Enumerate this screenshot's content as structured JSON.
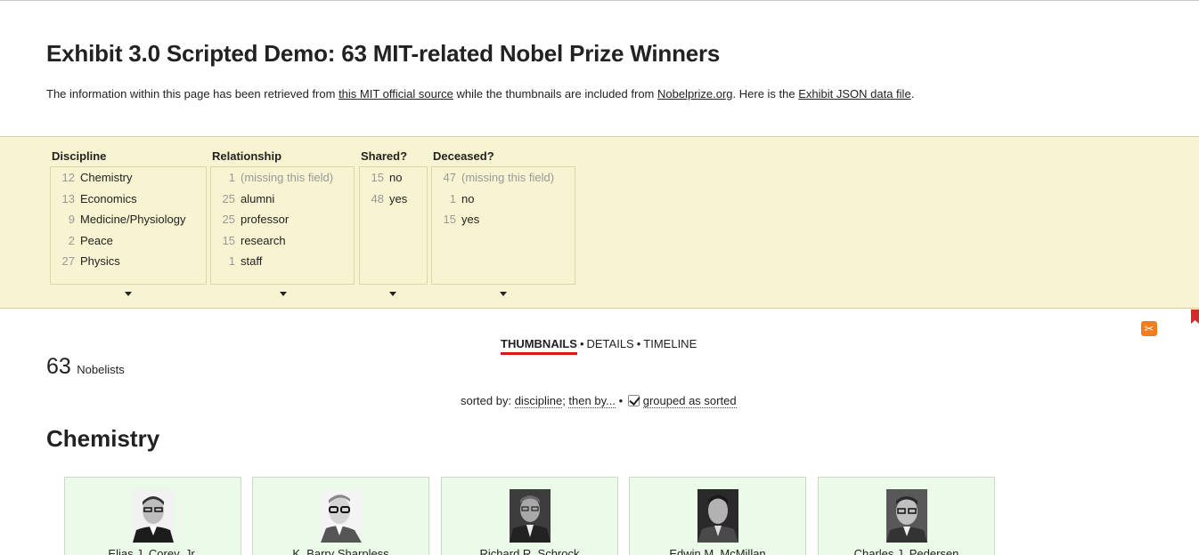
{
  "page": {
    "title": "Exhibit 3.0 Scripted Demo: 63 MIT-related Nobel Prize Winners",
    "intro": {
      "text1": "The information within this page has been retrieved from ",
      "link1": "this MIT official source",
      "text2": " while the thumbnails are included from ",
      "link2": "Nobelprize.org",
      "text3": ". Here is the ",
      "link3": "Exhibit JSON data file",
      "text4": "."
    }
  },
  "facets": {
    "discipline": {
      "title": "Discipline",
      "items": [
        {
          "count": "12",
          "label": "Chemistry"
        },
        {
          "count": "13",
          "label": "Economics"
        },
        {
          "count": "9",
          "label": "Medicine/Physiology"
        },
        {
          "count": "2",
          "label": "Peace"
        },
        {
          "count": "27",
          "label": "Physics"
        }
      ]
    },
    "relationship": {
      "title": "Relationship",
      "items": [
        {
          "count": "1",
          "label": "(missing this field)"
        },
        {
          "count": "25",
          "label": "alumni"
        },
        {
          "count": "25",
          "label": "professor"
        },
        {
          "count": "15",
          "label": "research"
        },
        {
          "count": "1",
          "label": "staff"
        }
      ]
    },
    "shared": {
      "title": "Shared?",
      "items": [
        {
          "count": "15",
          "label": "no"
        },
        {
          "count": "48",
          "label": "yes"
        }
      ]
    },
    "deceased": {
      "title": "Deceased?",
      "items": [
        {
          "count": "47",
          "label": "(missing this field)"
        },
        {
          "count": "1",
          "label": "no"
        },
        {
          "count": "15",
          "label": "yes"
        }
      ]
    }
  },
  "views": {
    "tabs": [
      "THUMBNAILS",
      "DETAILS",
      "TIMELINE"
    ],
    "separator": "•",
    "active": "THUMBNAILS"
  },
  "results": {
    "count": "63",
    "label": "Nobelists"
  },
  "sort": {
    "prefix": "sorted by: ",
    "primary": "discipline",
    "then": "then by...",
    "separator": "•",
    "grouped_label": "grouped as sorted",
    "grouped_checked": true
  },
  "group": {
    "title": "Chemistry"
  },
  "cards": [
    {
      "name": "Elias J. Corey, Jr."
    },
    {
      "name": "K. Barry Sharpless"
    },
    {
      "name": "Richard R. Schrock"
    },
    {
      "name": "Edwin M. McMillan"
    },
    {
      "name": "Charles J. Pedersen"
    }
  ],
  "icons": {
    "scissors": "scissors-icon",
    "bookmark": "bookmark-icon"
  },
  "colors": {
    "facet_background": "#f8f3d0",
    "card_background": "#ecfbe9",
    "active_tab_underline": "#d61b1b",
    "scissors_button": "#f07d1f",
    "bookmark": "#d42a2a"
  }
}
